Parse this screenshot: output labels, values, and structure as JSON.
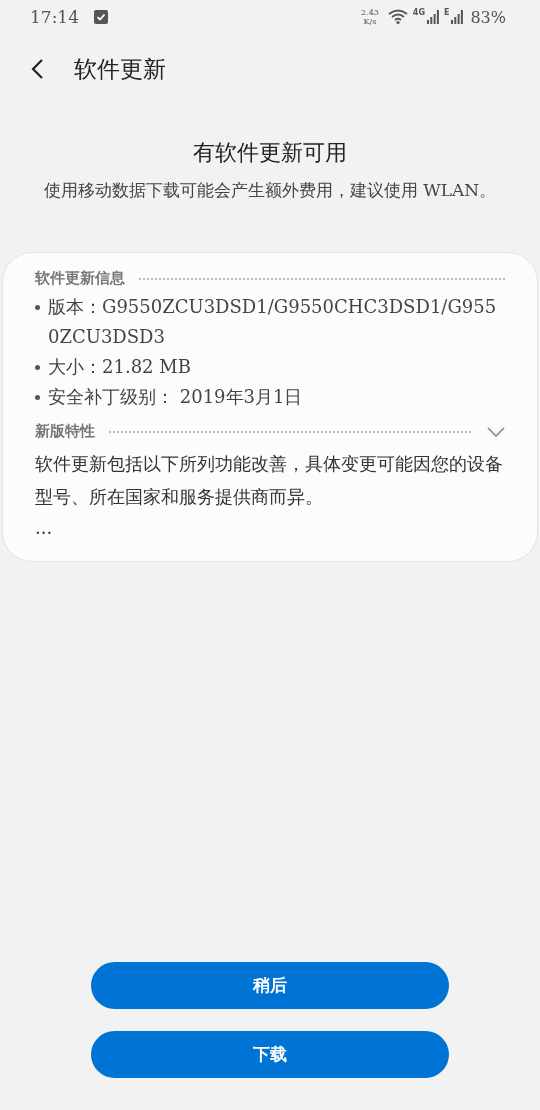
{
  "status_bar": {
    "time": "17:14",
    "speed_value": "2.43",
    "speed_unit": "K/s",
    "network_1": "4G",
    "network_2": "E",
    "battery": "83%"
  },
  "header": {
    "title": "软件更新"
  },
  "notice": {
    "title": "有软件更新可用",
    "message": "使用移动数据下载可能会产生额外费用，建议使用 WLAN。"
  },
  "info": {
    "heading": "软件更新信息",
    "items": [
      "版本：G9550ZCU3DSD1/G9550CHC3DSD1/G9550ZCU3DSD3",
      "大小：21.82 MB",
      "安全补丁级别： 2019年3月1日"
    ]
  },
  "features": {
    "heading": "新版特性",
    "expanded": false,
    "text": "软件更新包括以下所列功能改善，具体变更可能因您的设备型号、所在国家和服务提供商而异。",
    "more": "..."
  },
  "buttons": [
    "稍后",
    "下载"
  ]
}
